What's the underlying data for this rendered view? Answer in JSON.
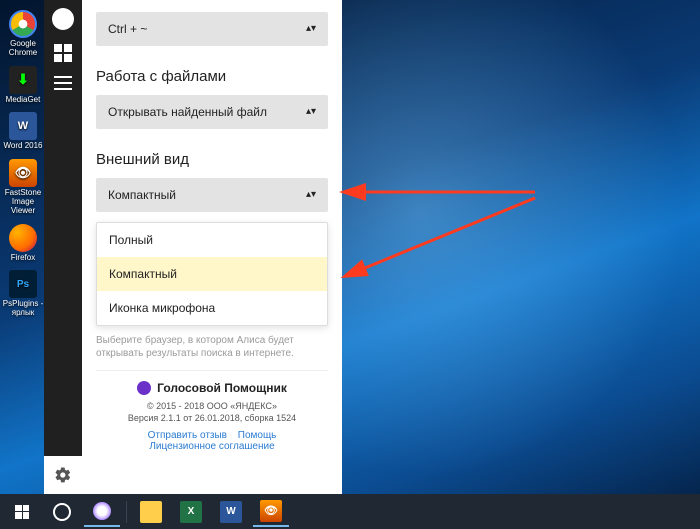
{
  "desktop": {
    "icons": [
      {
        "label": "Google Chrome"
      },
      {
        "label": "MediaGet"
      },
      {
        "label": "Word 2016"
      },
      {
        "label": "FastStone Image Viewer"
      },
      {
        "label": "Firefox"
      },
      {
        "label": "PsPlugins - ярлык"
      }
    ]
  },
  "panel": {
    "hotkey_section_value": "Ctrl + ~",
    "files_section_title": "Работа с файлами",
    "files_select_value": "Открывать найденный файл",
    "view_section_title": "Внешний вид",
    "view_select_value": "Компактный",
    "view_options": [
      "Полный",
      "Компактный",
      "Иконка микрофона"
    ],
    "browser_hint": "Выберите браузер, в котором Алиса будет открывать результаты поиска в интернете.",
    "footer_title": "Голосовой Помощник",
    "copyright": "© 2015 - 2018 ООО «ЯНДЕКС»",
    "version": "Версия 2.1.1 от 26.01.2018, сборка 1524",
    "link_feedback": "Отправить отзыв",
    "link_help": "Помощь",
    "link_license": "Лицензионное соглашение"
  },
  "colors": {
    "arrow": "#ff3b1f"
  }
}
